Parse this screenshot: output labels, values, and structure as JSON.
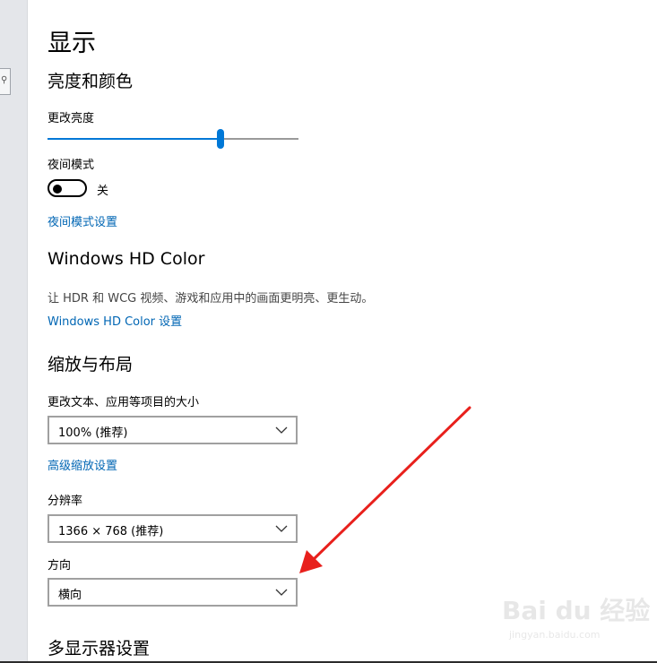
{
  "page": {
    "title": "显示",
    "sections": {
      "brightness": {
        "heading": "亮度和颜色",
        "brightness_label": "更改亮度",
        "brightness_level": 0.69,
        "night_mode_label": "夜间模式",
        "night_mode_state": "关",
        "night_mode_link": "夜间模式设置"
      },
      "hdr": {
        "heading": "Windows HD Color",
        "description": "让 HDR 和 WCG 视频、游戏和应用中的画面更明亮、更生动。",
        "link": "Windows HD Color 设置"
      },
      "scale": {
        "heading": "缩放与布局",
        "size_label": "更改文本、应用等项目的大小",
        "size_value": "100% (推荐)",
        "advanced_link": "高级缩放设置",
        "resolution_label": "分辨率",
        "resolution_value": "1366 × 768 (推荐)",
        "orientation_label": "方向",
        "orientation_value": "横向"
      },
      "multi_display": {
        "heading": "多显示器设置"
      }
    }
  },
  "colors": {
    "accent": "#0078d7",
    "link": "#0066b4",
    "annotation_arrow": "#e8201c"
  },
  "watermark": {
    "brand": "Bai du 经验",
    "url": "jingyan.baidu.com"
  }
}
